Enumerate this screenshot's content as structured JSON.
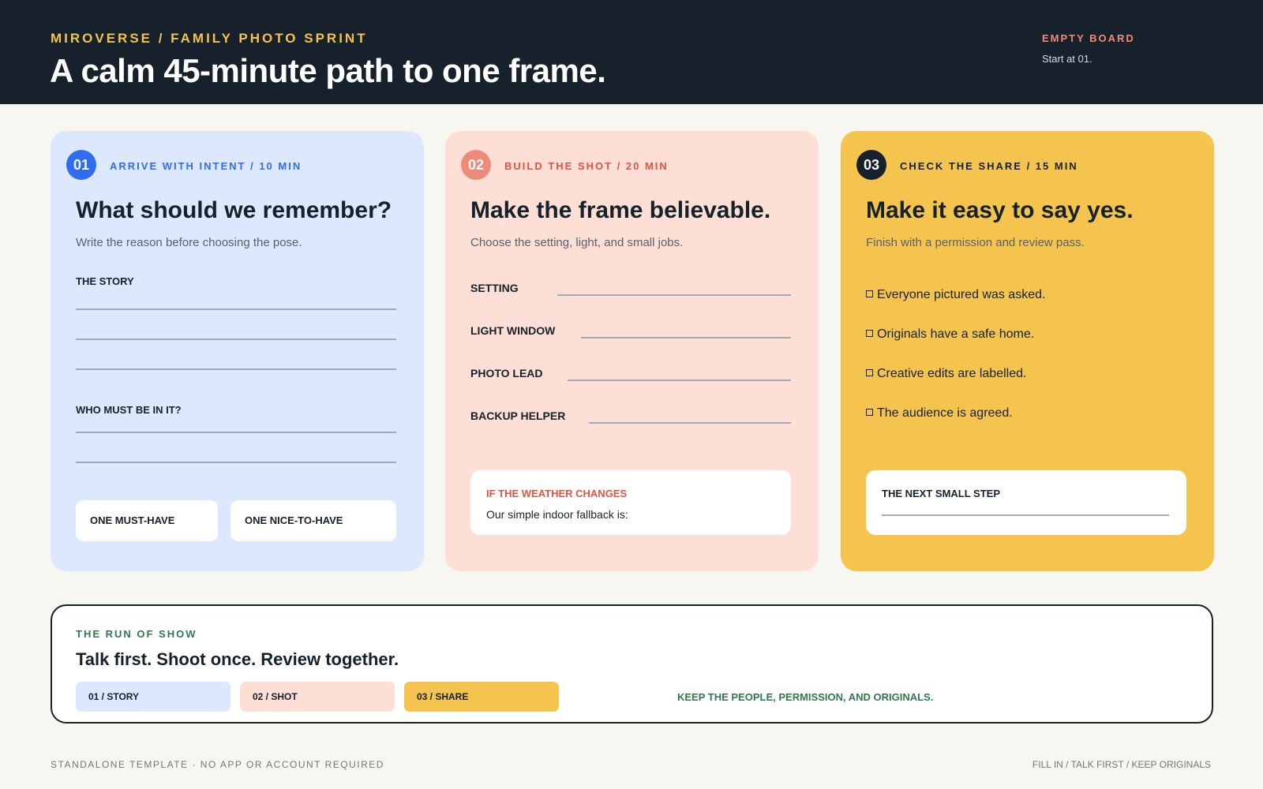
{
  "header": {
    "kicker": "MIROVERSE / FAMILY PHOTO SPRINT",
    "title": "A calm 45-minute path to one frame.",
    "status_label": "EMPTY BOARD",
    "status_text": "Start at 01."
  },
  "cards": [
    {
      "number": "01",
      "step": "ARRIVE WITH INTENT / 10 MIN",
      "heading": "What should we remember?",
      "subtitle": "Write the reason before choosing the pose.",
      "sections": [
        {
          "label": "THE STORY"
        },
        {
          "label": "WHO MUST BE IN IT?"
        }
      ],
      "chips": [
        "ONE MUST-HAVE",
        "ONE NICE-TO-HAVE"
      ]
    },
    {
      "number": "02",
      "step": "BUILD THE SHOT / 20 MIN",
      "heading": "Make the frame believable.",
      "subtitle": "Choose the setting, light, and small jobs.",
      "fields": [
        "SETTING",
        "LIGHT WINDOW",
        "PHOTO LEAD",
        "BACKUP HELPER"
      ],
      "note_title": "IF THE WEATHER CHANGES",
      "note_text": "Our simple indoor fallback is:"
    },
    {
      "number": "03",
      "step": "CHECK THE SHARE / 15 MIN",
      "heading": "Make it easy to say yes.",
      "subtitle": "Finish with a permission and review pass.",
      "checks": [
        "Everyone pictured was asked.",
        "Originals have a safe home.",
        "Creative edits are labelled.",
        "The audience is agreed."
      ],
      "next_title": "THE NEXT SMALL STEP"
    }
  ],
  "run_of_show": {
    "kicker": "THE RUN OF SHOW",
    "title": "Talk first. Shoot once. Review together.",
    "pills": [
      "01 / STORY",
      "02 / SHOT",
      "03 / SHARE"
    ],
    "note": "KEEP THE PEOPLE, PERMISSION, AND ORIGINALS."
  },
  "footer": {
    "left": "STANDALONE TEMPLATE · NO APP OR ACCOUNT REQUIRED",
    "right": "FILL IN / TALK FIRST / KEEP ORIGINALS"
  },
  "colors": {
    "header_bg": "#16212b",
    "accent_yellow": "#f4c34f",
    "blue": "#2f6cf0",
    "coral": "#f08a78",
    "green": "#2f7a4c"
  }
}
